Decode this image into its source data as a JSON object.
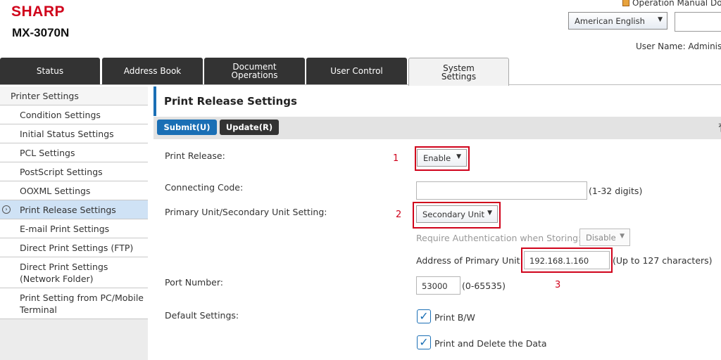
{
  "header": {
    "brand": "SHARP",
    "model": "MX-3070N",
    "manual_link": "Operation Manual Do",
    "language": "American English",
    "user_name": "User Name: Adminis"
  },
  "tabs": [
    {
      "label": "Status"
    },
    {
      "label": "Address Book"
    },
    {
      "label": "Document\nOperations"
    },
    {
      "label": "User Control"
    },
    {
      "label": "System\nSettings",
      "active": true
    }
  ],
  "sidebar": {
    "items": [
      {
        "label": "Printer Settings"
      },
      {
        "label": "Condition Settings"
      },
      {
        "label": "Initial Status Settings"
      },
      {
        "label": "PCL Settings"
      },
      {
        "label": "PostScript Settings"
      },
      {
        "label": "OOXML Settings"
      },
      {
        "label": "Print Release Settings",
        "active": true
      },
      {
        "label": "E-mail Print Settings"
      },
      {
        "label": "Direct Print Settings (FTP)"
      },
      {
        "label": "Direct Print Settings (Network Folder)"
      },
      {
        "label": "Print Setting from PC/Mobile Terminal"
      }
    ],
    "current_marker": "›"
  },
  "main": {
    "title": "Print Release Settings",
    "submit_label": "Submit(U)",
    "update_label": "Update(R)",
    "top_icon": "⤒",
    "print_release": {
      "label": "Print Release:",
      "value": "Enable",
      "annotation": "1"
    },
    "connecting_code": {
      "label": "Connecting Code:",
      "value": "",
      "hint": "(1-32 digits)"
    },
    "primary_secondary": {
      "label": "Primary Unit/Secondary Unit Setting:",
      "value": "Secondary Unit",
      "annotation": "2"
    },
    "require_auth": {
      "label": "Require Authentication when Storing:",
      "value": "Disable"
    },
    "primary_address": {
      "label": "Address of Primary Unit:",
      "value": "192.168.1.160",
      "hint": "(Up to 127 characters)",
      "annotation": "3"
    },
    "port_number": {
      "label": "Port Number:",
      "value": "53000",
      "hint": "(0-65535)"
    },
    "default_settings": {
      "label": "Default Settings:",
      "options": [
        {
          "label": "Print B/W",
          "checked": true
        },
        {
          "label": "Print and Delete the Data",
          "checked": true
        }
      ]
    }
  },
  "colors": {
    "accent": "#1a6fb5",
    "brand": "#d0021b",
    "annotation": "#d0021b",
    "tab_dark": "#333333"
  },
  "icons": {
    "check": "✓",
    "dropdown": "▼"
  }
}
